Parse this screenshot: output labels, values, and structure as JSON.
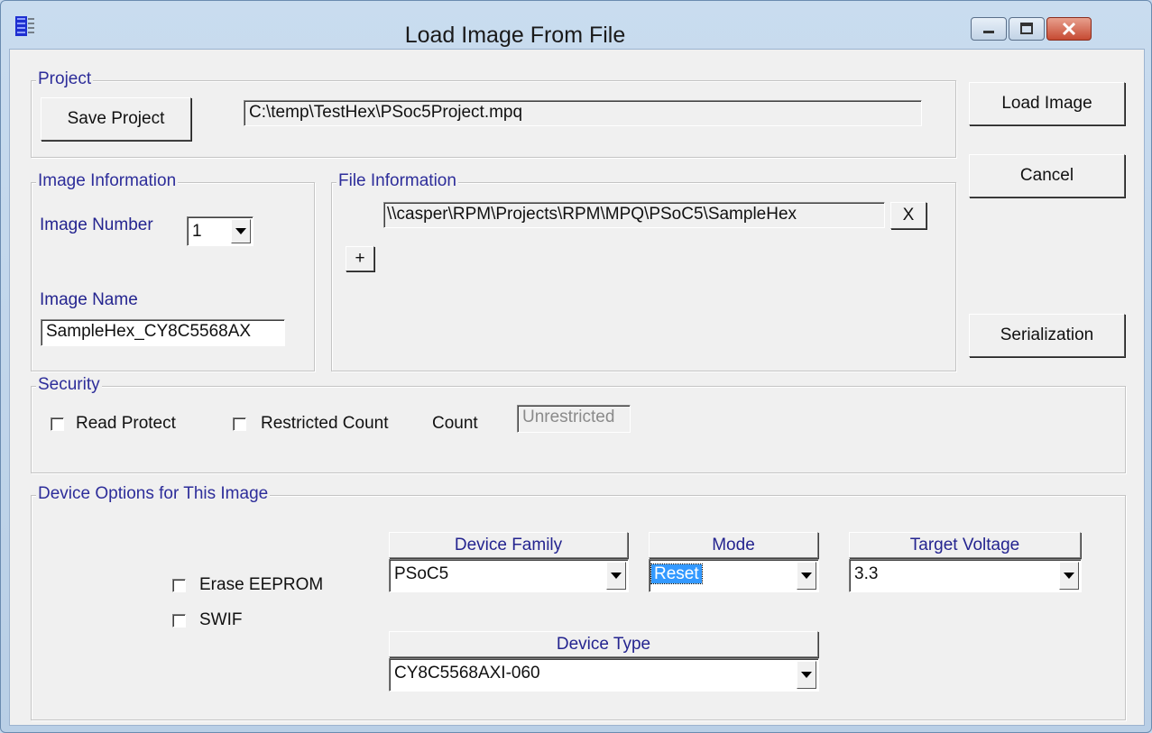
{
  "window": {
    "title": "Load Image From File",
    "controls": {
      "minimize": "minimize-icon",
      "maximize": "maximize-icon",
      "close": "close-icon"
    }
  },
  "project": {
    "legend": "Project",
    "save_label": "Save Project",
    "path": "C:\\temp\\TestHex\\PSoc5Project.mpq"
  },
  "actions": {
    "load_image": "Load Image",
    "cancel": "Cancel",
    "serialization": "Serialization"
  },
  "image_info": {
    "legend": "Image Information",
    "number_label": "Image Number",
    "number_value": "1",
    "name_label": "Image Name",
    "name_value": "SampleHex_CY8C5568AX"
  },
  "file_info": {
    "legend": "File Information",
    "file_path": "\\\\casper\\RPM\\Projects\\RPM\\MPQ\\PSoC5\\SampleHex",
    "remove_label": "X",
    "add_label": "+"
  },
  "security": {
    "legend": "Security",
    "read_protect": "Read Protect",
    "restricted_count": "Restricted Count",
    "count_label": "Count",
    "count_value": "Unrestricted"
  },
  "device": {
    "legend": "Device Options for This Image",
    "erase_eeprom": "Erase EEPROM",
    "swif": "SWIF",
    "family_header": "Device Family",
    "family_value": "PSoC5",
    "mode_header": "Mode",
    "mode_value": "Reset",
    "voltage_header": "Target Voltage",
    "voltage_value": "3.3",
    "type_header": "Device Type",
    "type_value": "CY8C5568AXI-060"
  },
  "colors": {
    "group_label": "#24248f",
    "selection": "#3399ff",
    "close_button": "#c64a32"
  }
}
